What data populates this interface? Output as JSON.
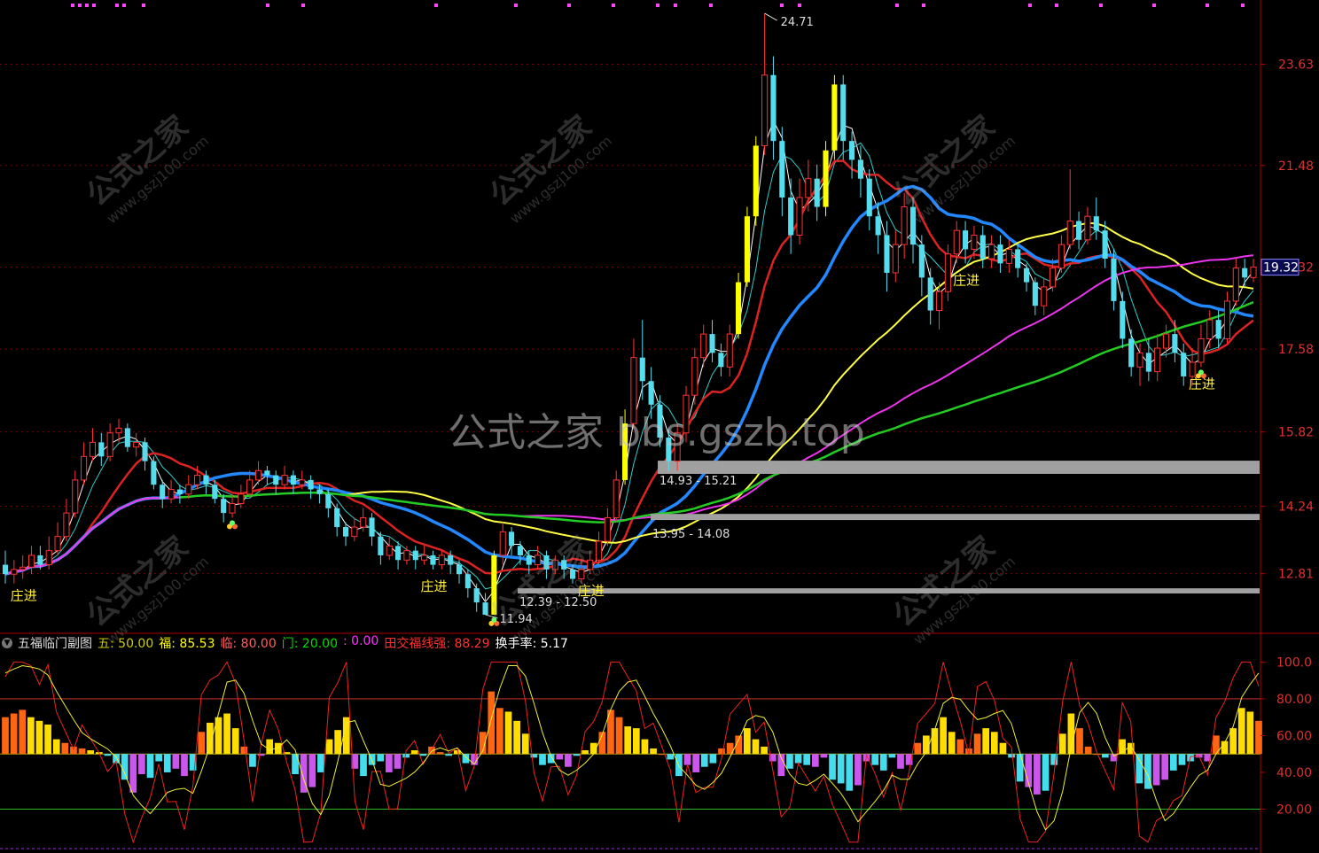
{
  "chart_data": {
    "type": "candlestick",
    "main_panel": {
      "price_axis_labels": [
        "23.63",
        "21.48",
        "19.32",
        "17.58",
        "15.82",
        "14.24",
        "12.81"
      ],
      "current_price": "19.32",
      "high_annotation": "24.71",
      "low_annotation": "11.94",
      "zones": [
        {
          "label": "14.93 - 15.21",
          "low": 14.93,
          "high": 15.21
        },
        {
          "label": "13.95 - 14.08",
          "low": 13.95,
          "high": 14.08
        },
        {
          "label": "12.39 - 12.50",
          "low": 12.39,
          "high": 12.5
        }
      ],
      "signal_label": "庄进",
      "bars": [
        [
          13.0,
          12.8,
          13.3,
          12.6
        ],
        [
          12.8,
          12.9,
          13.1,
          12.6
        ],
        [
          12.9,
          12.95,
          13.2,
          12.7
        ],
        [
          12.95,
          13.2,
          13.4,
          12.8
        ],
        [
          13.2,
          13.0,
          13.4,
          12.9
        ],
        [
          13.0,
          13.3,
          13.6,
          12.9
        ],
        [
          13.3,
          13.6,
          13.9,
          13.2
        ],
        [
          13.6,
          14.1,
          14.4,
          13.5
        ],
        [
          14.1,
          14.8,
          15.0,
          14.0
        ],
        [
          14.8,
          15.3,
          15.6,
          14.7
        ],
        [
          15.3,
          15.6,
          15.9,
          15.2
        ],
        [
          15.6,
          15.3,
          15.8,
          15.1
        ],
        [
          15.3,
          15.8,
          16.0,
          15.2
        ],
        [
          15.8,
          15.9,
          16.1,
          15.6
        ],
        [
          15.9,
          15.5,
          16.0,
          15.4
        ],
        [
          15.5,
          15.6,
          15.8,
          15.3
        ],
        [
          15.6,
          15.2,
          15.7,
          15.0
        ],
        [
          15.2,
          14.7,
          15.3,
          14.6
        ],
        [
          14.7,
          14.4,
          14.8,
          14.2
        ],
        [
          14.4,
          14.6,
          14.8,
          14.3
        ],
        [
          14.6,
          14.5,
          14.7,
          14.3
        ],
        [
          14.5,
          14.7,
          14.9,
          14.4
        ],
        [
          14.7,
          14.9,
          15.1,
          14.6
        ],
        [
          14.9,
          14.7,
          15.0,
          14.5
        ],
        [
          14.7,
          14.4,
          14.8,
          14.3
        ],
        [
          14.4,
          14.1,
          14.5,
          13.9
        ],
        [
          14.1,
          14.3,
          14.5,
          14.0
        ],
        [
          14.3,
          14.5,
          14.7,
          14.2
        ],
        [
          14.5,
          14.8,
          15.0,
          14.4
        ],
        [
          14.8,
          15.0,
          15.2,
          14.7
        ],
        [
          15.0,
          14.9,
          15.1,
          14.7
        ],
        [
          14.9,
          14.7,
          15.0,
          14.5
        ],
        [
          14.7,
          14.9,
          15.1,
          14.6
        ],
        [
          14.9,
          14.7,
          15.0,
          14.5
        ],
        [
          14.7,
          14.8,
          15.0,
          14.6
        ],
        [
          14.8,
          14.6,
          14.9,
          14.4
        ],
        [
          14.6,
          14.5,
          14.7,
          14.3
        ],
        [
          14.5,
          14.2,
          14.6,
          14.0
        ],
        [
          14.2,
          13.8,
          14.3,
          13.6
        ],
        [
          13.8,
          13.6,
          13.9,
          13.4
        ],
        [
          13.6,
          13.8,
          14.0,
          13.5
        ],
        [
          13.8,
          14.0,
          14.2,
          13.7
        ],
        [
          14.0,
          13.6,
          14.1,
          13.4
        ],
        [
          13.6,
          13.2,
          13.7,
          13.0
        ],
        [
          13.2,
          13.4,
          13.6,
          13.1
        ],
        [
          13.4,
          13.1,
          13.5,
          12.9
        ],
        [
          13.1,
          13.3,
          13.4,
          13.0
        ],
        [
          13.3,
          13.1,
          13.4,
          12.9
        ],
        [
          13.1,
          13.2,
          13.4,
          13.0
        ],
        [
          13.2,
          13.0,
          13.3,
          12.9
        ],
        [
          13.0,
          13.2,
          13.3,
          12.9
        ],
        [
          13.2,
          13.0,
          13.3,
          12.8
        ],
        [
          13.0,
          12.8,
          13.1,
          12.6
        ],
        [
          12.8,
          12.5,
          12.9,
          12.3
        ],
        [
          12.5,
          12.2,
          12.6,
          12.0
        ],
        [
          12.2,
          11.94,
          12.4,
          11.94
        ],
        [
          11.94,
          13.2,
          13.3,
          11.94
        ],
        [
          13.2,
          13.7,
          13.9,
          13.0
        ],
        [
          13.7,
          13.4,
          13.8,
          13.2
        ],
        [
          13.4,
          13.2,
          13.5,
          13.0
        ],
        [
          13.2,
          13.0,
          13.3,
          12.8
        ],
        [
          13.0,
          13.2,
          13.4,
          12.9
        ],
        [
          13.2,
          12.9,
          13.3,
          12.7
        ],
        [
          12.9,
          13.1,
          13.2,
          12.8
        ],
        [
          13.1,
          12.9,
          13.2,
          12.7
        ],
        [
          12.9,
          12.7,
          13.0,
          12.6
        ],
        [
          12.7,
          12.9,
          13.1,
          12.6
        ],
        [
          12.9,
          13.1,
          13.3,
          12.8
        ],
        [
          13.1,
          13.5,
          13.7,
          13.0
        ],
        [
          13.5,
          14.0,
          14.2,
          13.4
        ],
        [
          14.0,
          14.8,
          15.0,
          13.9
        ],
        [
          14.8,
          16.0,
          16.3,
          14.7
        ],
        [
          16.0,
          17.4,
          17.8,
          15.9
        ],
        [
          17.4,
          16.9,
          18.2,
          16.5
        ],
        [
          16.9,
          16.4,
          17.2,
          16.1
        ],
        [
          16.4,
          15.7,
          16.6,
          15.5
        ],
        [
          15.7,
          15.2,
          15.9,
          15.0
        ],
        [
          15.2,
          15.8,
          16.0,
          15.0
        ],
        [
          15.8,
          16.6,
          16.8,
          15.6
        ],
        [
          16.6,
          17.4,
          17.6,
          16.4
        ],
        [
          17.4,
          17.9,
          18.1,
          17.2
        ],
        [
          17.9,
          17.5,
          18.2,
          17.3
        ],
        [
          17.5,
          17.2,
          17.7,
          17.0
        ],
        [
          17.2,
          17.9,
          18.1,
          17.0
        ],
        [
          17.9,
          19.0,
          19.2,
          17.8
        ],
        [
          19.0,
          20.4,
          20.6,
          18.9
        ],
        [
          20.4,
          21.9,
          22.1,
          20.2
        ],
        [
          21.9,
          23.4,
          24.71,
          21.7
        ],
        [
          23.4,
          22.0,
          23.8,
          21.6
        ],
        [
          22.0,
          20.8,
          22.3,
          20.4
        ],
        [
          20.8,
          20.0,
          21.2,
          19.6
        ],
        [
          20.0,
          20.8,
          21.2,
          19.8
        ],
        [
          20.8,
          21.2,
          21.6,
          20.5
        ],
        [
          21.2,
          20.6,
          21.5,
          20.3
        ],
        [
          20.6,
          21.8,
          22.0,
          20.4
        ],
        [
          21.8,
          23.2,
          23.4,
          21.6
        ],
        [
          23.2,
          22.0,
          23.4,
          21.6
        ],
        [
          22.0,
          21.6,
          22.2,
          21.2
        ],
        [
          21.6,
          21.2,
          21.9,
          20.8
        ],
        [
          21.2,
          20.4,
          21.4,
          20.1
        ],
        [
          20.4,
          20.0,
          20.7,
          19.6
        ],
        [
          20.0,
          19.2,
          20.3,
          18.8
        ],
        [
          19.2,
          19.8,
          20.1,
          19.0
        ],
        [
          19.8,
          20.6,
          20.9,
          19.5
        ],
        [
          20.6,
          19.8,
          20.8,
          19.4
        ],
        [
          19.8,
          19.1,
          20.0,
          18.7
        ],
        [
          19.1,
          18.4,
          19.3,
          18.1
        ],
        [
          18.4,
          18.8,
          19.0,
          18.0
        ],
        [
          18.8,
          19.6,
          19.8,
          18.6
        ],
        [
          19.6,
          20.1,
          20.3,
          19.4
        ],
        [
          20.1,
          19.7,
          20.3,
          19.4
        ],
        [
          19.7,
          20.0,
          20.2,
          19.5
        ],
        [
          20.0,
          19.5,
          20.2,
          19.3
        ],
        [
          19.5,
          19.8,
          20.0,
          19.3
        ],
        [
          19.8,
          19.4,
          20.0,
          19.2
        ],
        [
          19.4,
          19.7,
          19.9,
          19.2
        ],
        [
          19.7,
          19.3,
          19.8,
          19.1
        ],
        [
          19.3,
          19.0,
          19.4,
          18.8
        ],
        [
          19.0,
          18.5,
          19.1,
          18.3
        ],
        [
          18.5,
          18.9,
          19.1,
          18.3
        ],
        [
          18.9,
          19.3,
          19.5,
          18.8
        ],
        [
          19.3,
          19.8,
          20.0,
          19.2
        ],
        [
          19.8,
          20.3,
          21.4,
          19.7
        ],
        [
          20.3,
          19.9,
          20.5,
          19.7
        ],
        [
          19.9,
          20.4,
          20.6,
          19.8
        ],
        [
          20.4,
          20.1,
          20.8,
          19.9
        ],
        [
          20.1,
          19.5,
          20.3,
          19.3
        ],
        [
          19.5,
          18.6,
          19.7,
          18.4
        ],
        [
          18.6,
          17.8,
          18.8,
          17.6
        ],
        [
          17.8,
          17.2,
          18.0,
          17.0
        ],
        [
          17.2,
          17.5,
          17.7,
          16.8
        ],
        [
          17.5,
          17.1,
          17.8,
          16.9
        ],
        [
          17.1,
          17.6,
          17.9,
          16.9
        ],
        [
          17.6,
          17.9,
          18.1,
          17.4
        ],
        [
          17.9,
          17.5,
          18.2,
          17.3
        ],
        [
          17.5,
          17.0,
          17.7,
          16.8
        ],
        [
          17.0,
          17.3,
          17.6,
          16.8
        ],
        [
          17.3,
          17.8,
          18.1,
          17.2
        ],
        [
          17.8,
          18.2,
          18.4,
          17.6
        ],
        [
          18.2,
          17.8,
          18.4,
          17.6
        ],
        [
          17.8,
          18.6,
          18.8,
          17.7
        ],
        [
          18.6,
          19.3,
          19.5,
          18.5
        ],
        [
          19.3,
          19.1,
          19.5,
          18.9
        ],
        [
          19.1,
          19.32,
          19.5,
          19.0
        ]
      ]
    },
    "sub_panel": {
      "title": "五福临门副图",
      "legend": [
        {
          "label": "五:",
          "value": "50.00",
          "color": "#cccc00"
        },
        {
          "label": "福:",
          "value": "85.53",
          "color": "#ffff00"
        },
        {
          "label": "临:",
          "value": "80.00",
          "color": "#ff6060"
        },
        {
          "label": "门:",
          "value": "20.00",
          "color": "#00dd00"
        },
        {
          "label": ":",
          "value": "0.00",
          "color": "#ff33ff"
        },
        {
          "label": "田交福线强:",
          "value": "88.29",
          "color": "#ff3030"
        },
        {
          "label": "换手率:",
          "value": "5.17",
          "color": "#ffffff"
        }
      ],
      "y_axis_labels": [
        "100.0",
        "80.00",
        "60.00",
        "40.00",
        "20.00"
      ],
      "ylim": [
        0,
        105
      ],
      "hist": [
        70,
        72,
        74,
        70,
        68,
        66,
        58,
        56,
        54,
        53,
        52,
        51,
        49,
        45,
        36,
        29,
        39,
        37,
        46,
        40,
        42,
        38,
        41,
        62,
        67,
        70,
        72,
        64,
        54,
        43,
        49,
        58,
        56,
        51,
        39,
        29,
        32,
        40,
        58,
        63,
        70,
        42,
        38,
        44,
        46,
        40,
        42,
        48,
        52,
        49,
        54,
        51,
        49,
        52,
        45,
        44,
        62,
        84,
        75,
        73,
        68,
        61,
        48,
        44,
        45,
        47,
        43,
        49,
        52,
        56,
        62,
        74,
        70,
        65,
        64,
        58,
        53,
        50,
        47,
        38,
        44,
        40,
        43,
        45,
        53,
        56,
        60,
        64,
        58,
        54,
        46,
        38,
        42,
        45,
        44,
        43,
        48,
        36,
        34,
        30,
        33,
        46,
        44,
        41,
        48,
        42,
        44,
        56,
        60,
        64,
        70,
        62,
        58,
        53,
        61,
        64,
        62,
        56,
        48,
        35,
        32,
        28,
        30,
        44,
        61,
        72,
        64,
        54,
        50,
        48,
        46,
        58,
        56,
        34,
        31,
        33,
        36,
        41,
        44,
        46,
        48,
        46,
        60,
        57,
        64,
        75,
        73,
        68
      ]
    }
  }
}
